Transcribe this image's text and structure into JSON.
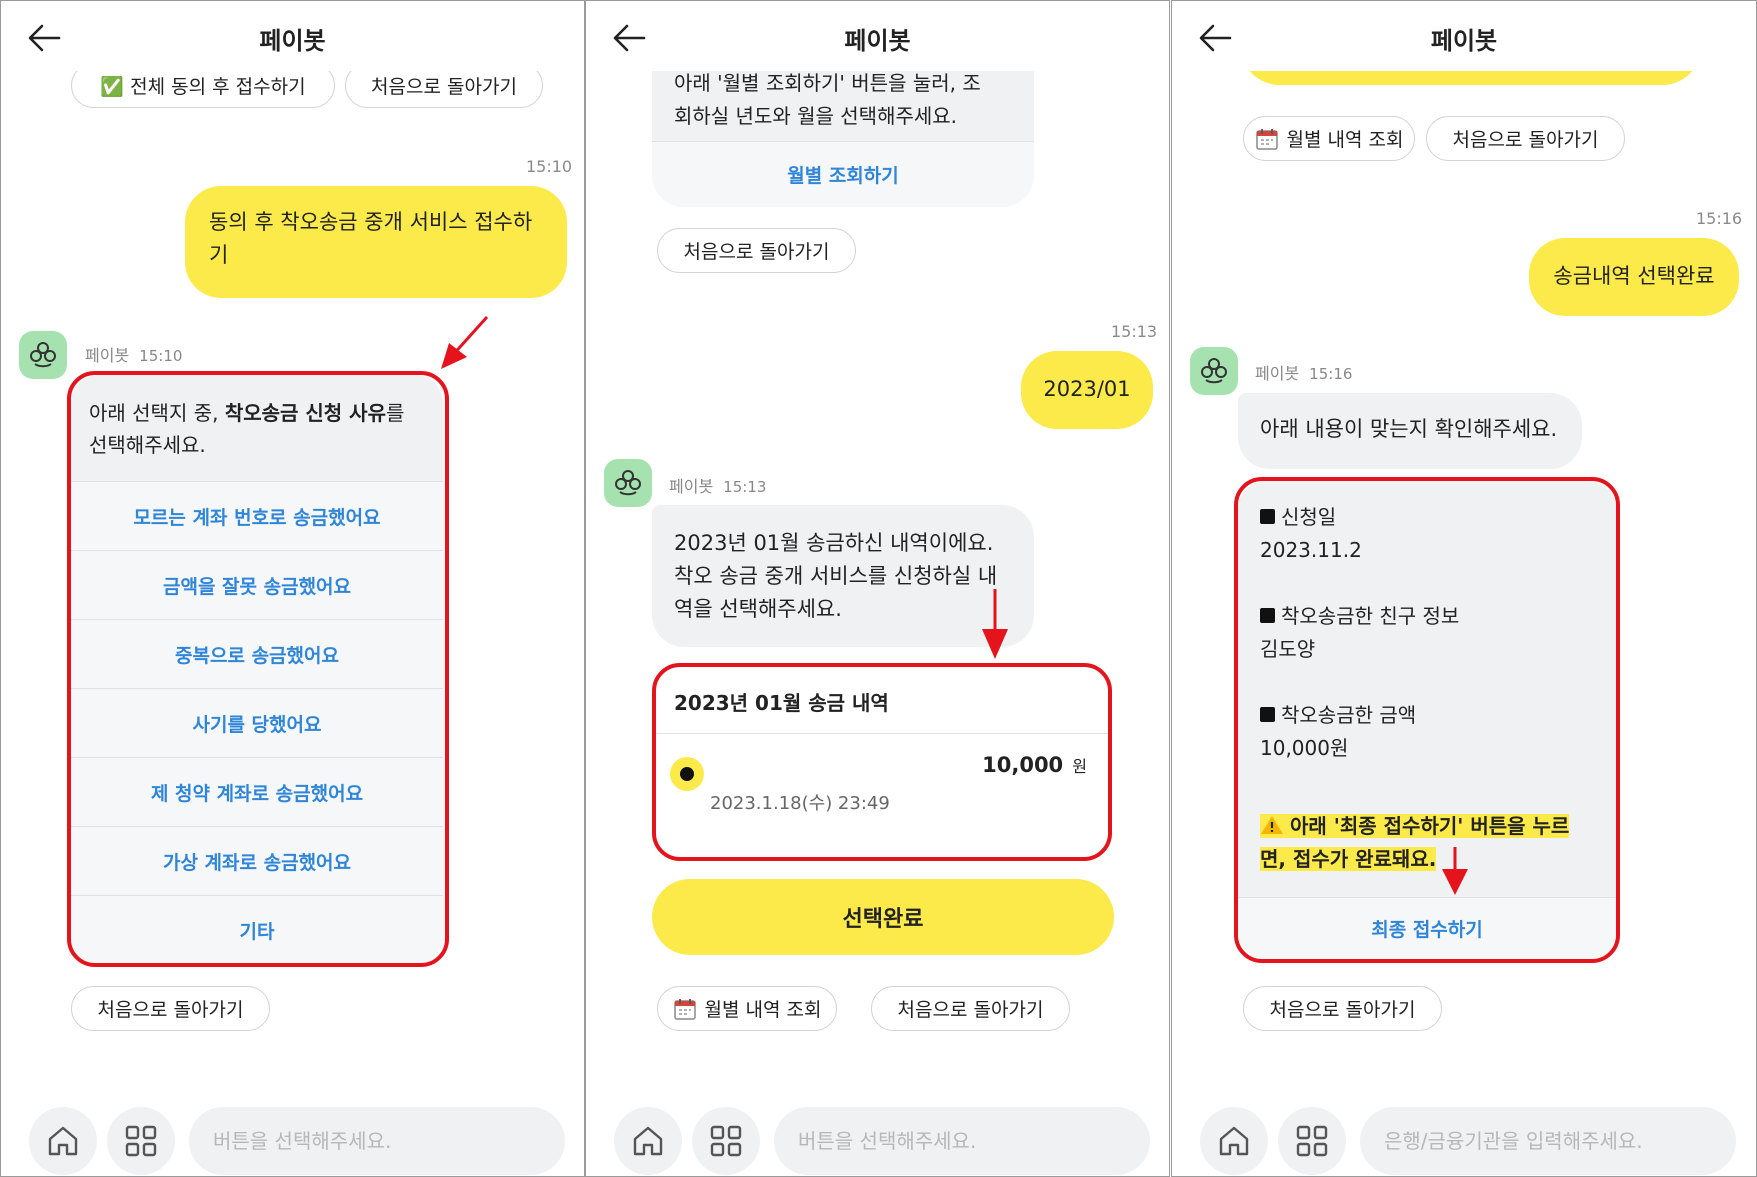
{
  "header": {
    "title": "페이봇"
  },
  "bot": {
    "name": "페이봇"
  },
  "panel1": {
    "chips_top": [
      "✅ 전체 동의 후 접수하기",
      "처음으로 돌아가기"
    ],
    "user_time": "15:10",
    "user_message_line1": "동의 후 착오송금 중개 서비스 접수하",
    "user_message_line2": "기",
    "bot_time": "15:10",
    "question_prefix": "아래 선택지 중, ",
    "question_bold": "착오송금 신청 사유",
    "question_suffix": "를",
    "question_line2": "선택해주세요.",
    "options": [
      "모르는 계좌 번호로 송금했어요",
      "금액을 잘못 송금했어요",
      "중복으로 송금했어요",
      "사기를 당했어요",
      "제 청약 계좌로 송금했어요",
      "가상 계좌로 송금했어요",
      "기타"
    ],
    "chip_bottom": "처음으로 돌아가기",
    "input_placeholder": "버튼을 선택해주세요."
  },
  "panel2": {
    "partial_line1": "아래 '월별 조회하기' 버튼을 눌러, 조",
    "partial_line2": "회하실 년도와 월을 선택해주세요.",
    "monthly_button": "월별 조회하기",
    "chip_back_top": "처음으로 돌아가기",
    "user_time": "15:13",
    "user_message": "2023/01",
    "bot_time": "15:13",
    "bot_lines": [
      "2023년 01월 송금하신 내역이에요.",
      "착오 송금 중개 서비스를 신청하실 내",
      "역을 선택해주세요."
    ],
    "history_title": "2023년 01월 송금 내역",
    "history_date": "2023.1.18(수) 23:49",
    "history_amount": "10,000",
    "history_unit": "원",
    "select_done": "선택완료",
    "chip_monthly": "월별 내역 조회",
    "chip_back": "처음으로 돌아가기",
    "input_placeholder": "버튼을 선택해주세요."
  },
  "panel3": {
    "chip_monthly": "월별 내역 조회",
    "chip_back_top": "처음으로 돌아가기",
    "user_time": "15:16",
    "user_message": "송금내역 선택완료",
    "bot_time": "15:16",
    "bot_message": "아래 내용이 맞는지 확인해주세요.",
    "label_date": "신청일",
    "value_date": "2023.11.2",
    "label_friend": "착오송금한 친구 정보",
    "value_friend": "김도양",
    "label_amount": "착오송금한 금액",
    "value_amount": "10,000원",
    "warning_line1": "아래 '최종 접수하기' 버튼을 누르",
    "warning_line2": "면, 접수가 완료돼요.",
    "final_button": "최종 접수하기",
    "chip_back": "처음으로 돌아가기",
    "input_placeholder": "은행/금융기관을 입력해주세요."
  },
  "colors": {
    "accent_yellow": "#fbea4a",
    "link_blue": "#2f86d8",
    "annotation_red": "#e5141c",
    "bot_avatar": "#a6e2b0"
  },
  "icons": [
    "back-arrow-icon",
    "home-icon",
    "grid-icon",
    "calendar-icon",
    "check-icon",
    "warning-icon",
    "bot-avatar-icon",
    "red-arrow-icon"
  ]
}
